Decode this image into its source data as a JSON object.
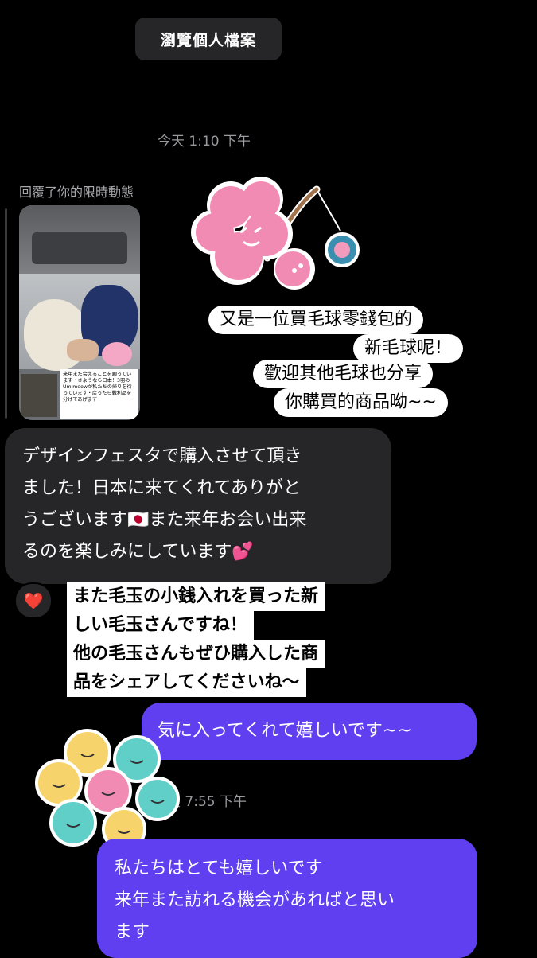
{
  "header": {
    "view_profile_label": "瀏覽個人檔案"
  },
  "timestamps": [
    "今天 1:10 下午",
    "天 7:55 下午"
  ],
  "story_reply": {
    "label": "回覆了你的限時動態",
    "thumbnail_text": "来年また会えることを願っています・さようなら日本！3羽のUmimeowが私たちの帰りを待っています・戻ったら戦利品を分けてあげます"
  },
  "messages": {
    "received_caption_zh": [
      "又是一位買毛球零錢包的",
      "新毛球呢！",
      "歡迎其他毛球也分享",
      "你購買的商品呦~~"
    ],
    "sent_gray_lines": [
      "デザインフェスタで購入させて頂き",
      "ました！日本に来てくれてありがと",
      "うございます🇯🇵また来年お会い出来",
      "るのを楽しみにしています💕"
    ],
    "reaction": "❤️",
    "jp_caption": [
      "また毛玉の小銭入れを買った新",
      "しい毛玉さんですね！",
      "他の毛玉さんもぜひ購入した商",
      "品をシェアしてくださいね〜"
    ],
    "purple_1": "気に入ってくれて嬉しいです~~",
    "purple_2_lines": [
      "私たちはとても嬉しいです",
      "来年また訪れる機会があればと思い",
      "ます"
    ]
  },
  "colors": {
    "background": "#000000",
    "received_bubble": "#262628",
    "sent_bubble": "#5f3ff0",
    "sticker_pink": "#f28bb4"
  }
}
